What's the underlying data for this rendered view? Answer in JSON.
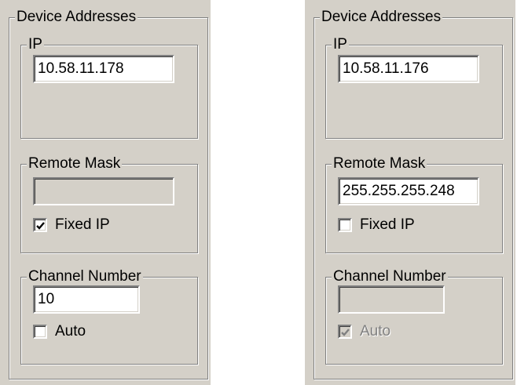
{
  "panels": [
    {
      "title": "Device Addresses",
      "ip": {
        "label": "IP",
        "value": "10.58.11.178"
      },
      "remote_mask": {
        "label": "Remote Mask",
        "value": "",
        "enabled": false
      },
      "fixed_ip": {
        "label": "Fixed IP",
        "checked": true,
        "enabled": true
      },
      "channel_number": {
        "label": "Channel Number",
        "value": "10",
        "enabled": true
      },
      "auto": {
        "label": "Auto",
        "checked": false,
        "enabled": true
      }
    },
    {
      "title": "Device Addresses",
      "ip": {
        "label": "IP",
        "value": "10.58.11.176"
      },
      "remote_mask": {
        "label": "Remote Mask",
        "value": "255.255.255.248",
        "enabled": true
      },
      "fixed_ip": {
        "label": "Fixed IP",
        "checked": false,
        "enabled": true
      },
      "channel_number": {
        "label": "Channel Number",
        "value": "",
        "enabled": false
      },
      "auto": {
        "label": "Auto",
        "checked": true,
        "enabled": false
      }
    }
  ],
  "colors": {
    "dialog_face": "#d4d0c8",
    "shadow": "#808080",
    "highlight": "#ffffff",
    "disabled_text": "#808080"
  },
  "icons": {
    "checkmark": "checkmark-icon"
  }
}
